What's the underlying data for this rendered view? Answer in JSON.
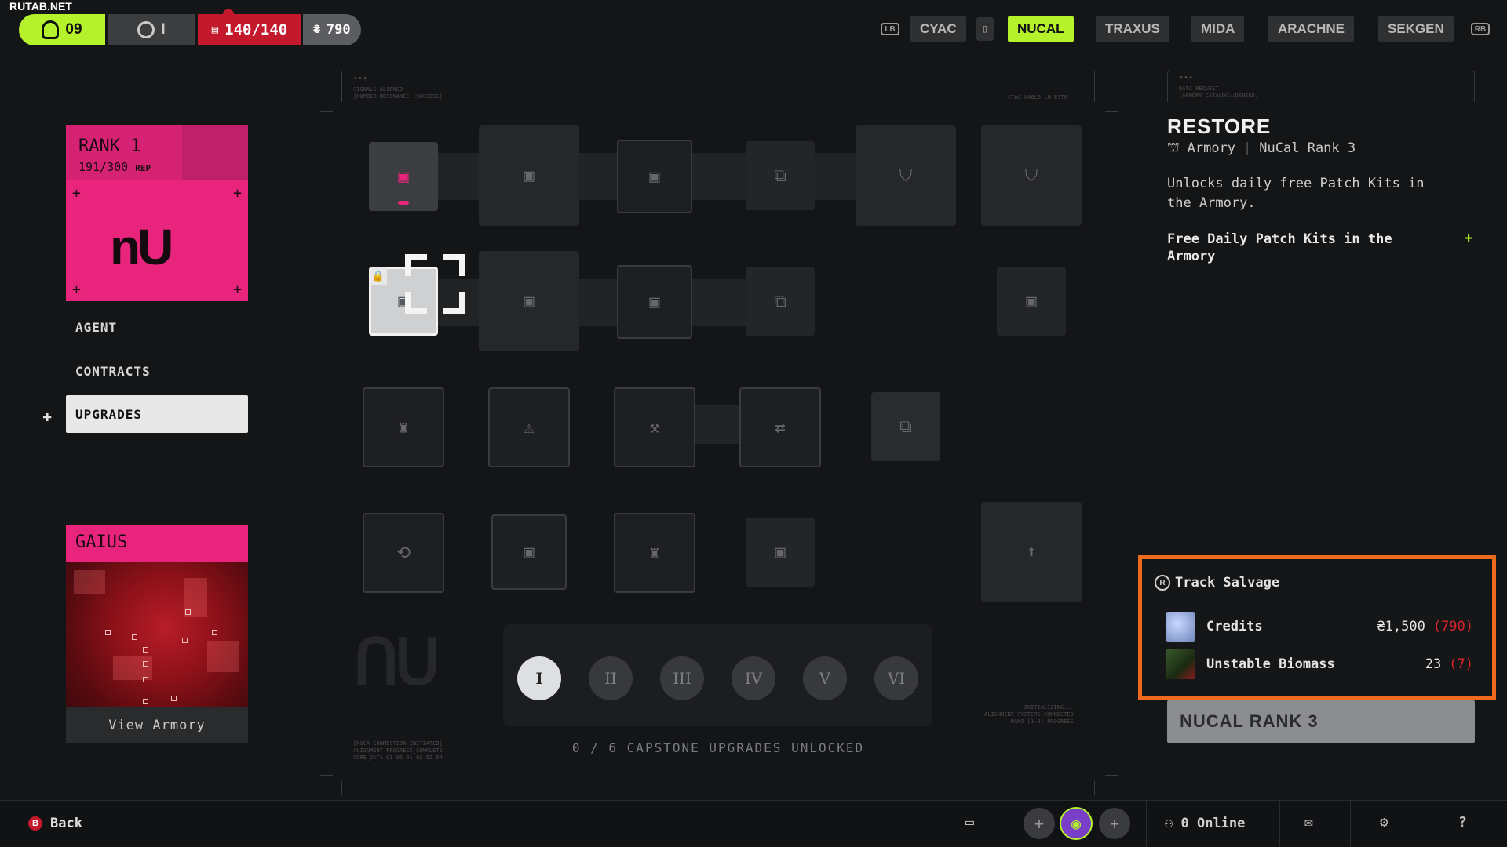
{
  "watermark": "RUTAB.NET",
  "topbar": {
    "level": "09",
    "extract_label": "I",
    "health": "140/140",
    "currency": "790",
    "lb": "LB",
    "rb": "RB",
    "factions": [
      "CYAC",
      "NUCAL",
      "TRAXUS",
      "MIDA",
      "ARACHNE",
      "SEKGEN"
    ],
    "active_faction": "NUCAL"
  },
  "left": {
    "rank_title": "RANK 1",
    "rank_rep": "191/300",
    "rank_rep_unit": "REP",
    "logo_text": "nU",
    "nav": [
      {
        "label": "AGENT",
        "selected": false
      },
      {
        "label": "CONTRACTS",
        "selected": false
      },
      {
        "label": "UPGRADES",
        "selected": true
      }
    ],
    "handler_name": "GAIUS",
    "view_armory": "View Armory"
  },
  "tree": {
    "capstone_text": "0 / 6 CAPSTONE UPGRADES UNLOCKED",
    "tiers": [
      "I",
      "II",
      "III",
      "IV",
      "V",
      "VI"
    ],
    "active_tier": "I",
    "header_left": "SIGNALS ALIGNED\n[NUMBER RESONANCE::SUCCESS]",
    "header_right": "CYAC_NAGLS_LH_EST8",
    "footer_left": "[NUCA CONNECTION INITIATED]\nALIGNMENT PROGRESS_COMPLETE\nCORE_DATA 01 05 01 62 52 04",
    "footer_right": "INITIALIZING...\nALIGNMENT SYSTEMS CONNECTED\nNANO [1-0] PROGRESS"
  },
  "upgrade": {
    "frame_text": "DATA REQUEST\n[ARMORY CATALOG::DENIED]",
    "title": "RESTORE",
    "category": "Armory",
    "requirement": "NuCal Rank 3",
    "description": "Unlocks daily free Patch Kits in the Armory.",
    "effect": "Free Daily Patch Kits in the Armory",
    "effect_marker": "+"
  },
  "salvage": {
    "title": "Track Salvage",
    "items": [
      {
        "name": "Credits",
        "required": "1,500",
        "have": "(790)",
        "has_currency_icon": true
      },
      {
        "name": "Unstable Biomass",
        "required": "23",
        "have": "(7)",
        "has_currency_icon": false
      }
    ]
  },
  "rank_button": "NUCAL RANK 3",
  "bottombar": {
    "back_key": "B",
    "back_label": "Back",
    "online": "0 Online"
  },
  "colors": {
    "accent": "#b6f22c",
    "nucal_pink": "#e8247c",
    "health_red": "#c4182c",
    "highlight_orange": "#ee6a1f",
    "shortfall_red": "#d8242e"
  }
}
